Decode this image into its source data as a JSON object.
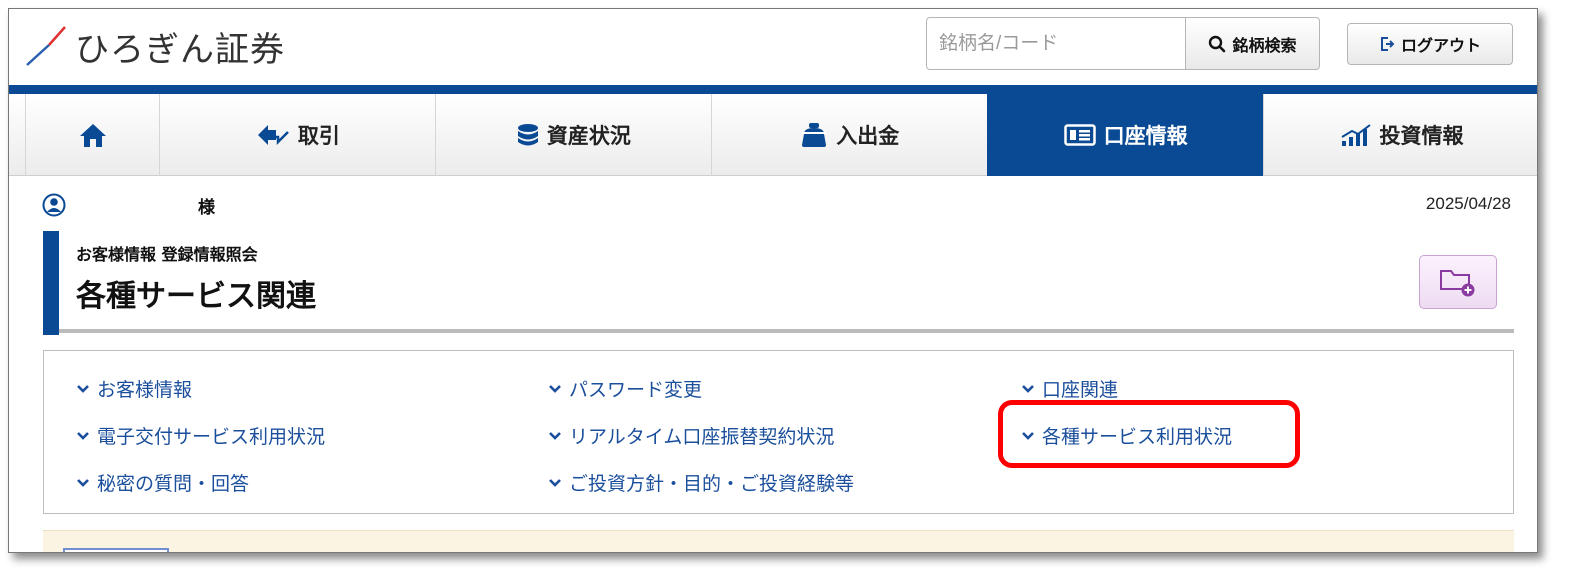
{
  "header": {
    "logo_text": "ひろぎん証券",
    "search_placeholder": "銘柄名/コード",
    "search_button": "銘柄検索",
    "logout_button": "ログアウト"
  },
  "nav": {
    "items": [
      {
        "label": "取引"
      },
      {
        "label": "資産状況"
      },
      {
        "label": "入出金"
      },
      {
        "label": "口座情報",
        "active": true
      },
      {
        "label": "投資情報"
      }
    ]
  },
  "user": {
    "suffix": "様",
    "date": "2025/04/28"
  },
  "page": {
    "breadcrumb": "お客様情報 登録情報照会",
    "title": "各種サービス関連"
  },
  "links": {
    "col1": [
      "お客様情報",
      "電子交付サービス利用状況",
      "秘密の質問・回答"
    ],
    "col2": [
      "パスワード変更",
      "リアルタイム口座振替契約状況",
      "ご投資方針・目的・ご投資経験等"
    ],
    "col3": [
      "口座関連",
      "各種サービス利用状況"
    ]
  },
  "colors": {
    "brand_blue": "#0a4a94",
    "link_blue": "#1b4f9c",
    "highlight_red": "#ff0000"
  }
}
